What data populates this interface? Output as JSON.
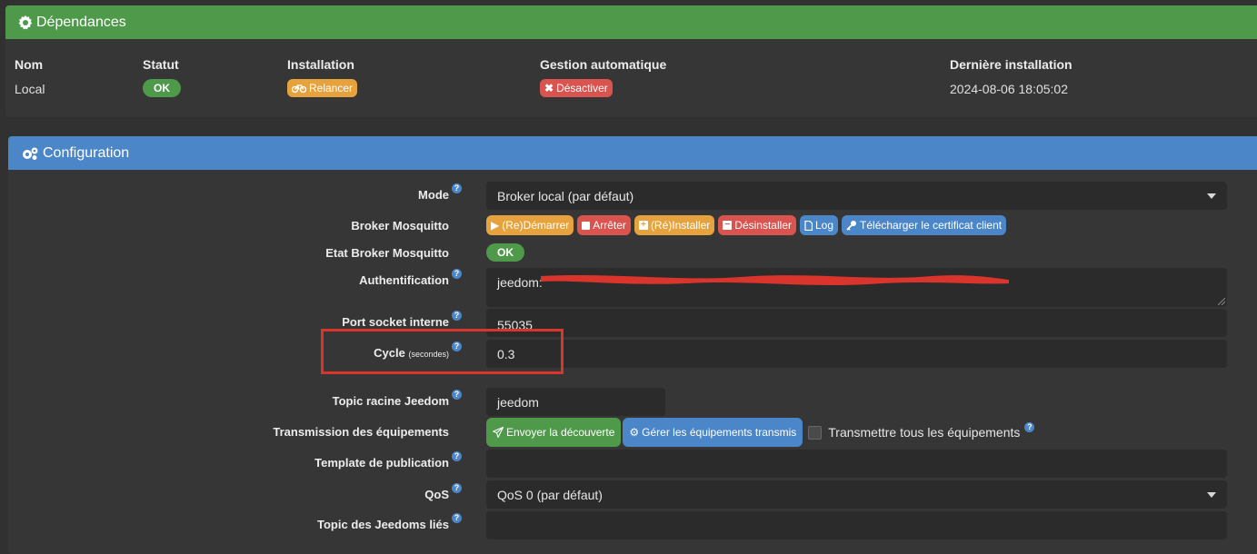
{
  "dependencies": {
    "title": "Dépendances",
    "headers": {
      "name": "Nom",
      "status": "Statut",
      "install": "Installation",
      "auto": "Gestion automatique",
      "last": "Dernière installation"
    },
    "row": {
      "name": "Local",
      "status": "OK",
      "install_button": "Relancer",
      "auto_button": "Désactiver",
      "last": "2024-08-06 18:05:02"
    }
  },
  "configuration": {
    "title": "Configuration",
    "mode": {
      "label": "Mode",
      "value": "Broker local (par défaut)"
    },
    "broker": {
      "label": "Broker Mosquitto",
      "buttons": {
        "start": "(Re)Démarrer",
        "stop": "Arrêter",
        "install": "(Ré)Installer",
        "uninstall": "Désinstaller",
        "log": "Log",
        "cert": "Télécharger le certificat client"
      }
    },
    "broker_state": {
      "label": "Etat Broker Mosquitto",
      "value": "OK"
    },
    "auth": {
      "label": "Authentification",
      "value": "jeedom:"
    },
    "socket_port": {
      "label": "Port socket interne",
      "value": "55035"
    },
    "cycle": {
      "label": "Cycle",
      "unit": "(secondes)",
      "value": "0.3"
    },
    "root_topic": {
      "label": "Topic racine Jeedom",
      "value": "jeedom"
    },
    "transmission": {
      "label": "Transmission des équipements",
      "discover_button": "Envoyer la découverte",
      "manage_button": "Gérer les équipements transmis",
      "all_label": "Transmettre tous les équipements"
    },
    "template": {
      "label": "Template de publication",
      "value": ""
    },
    "qos": {
      "label": "QoS",
      "value": "QoS 0 (par défaut)"
    },
    "linked_topics": {
      "label": "Topic des Jeedoms liés",
      "value": ""
    },
    "help_glyph": "?"
  },
  "colors": {
    "success": "#4f9a4a",
    "primary": "#4a86c8",
    "warning": "#e6a23c",
    "danger": "#d9534f",
    "highlight": "#d9352c"
  }
}
